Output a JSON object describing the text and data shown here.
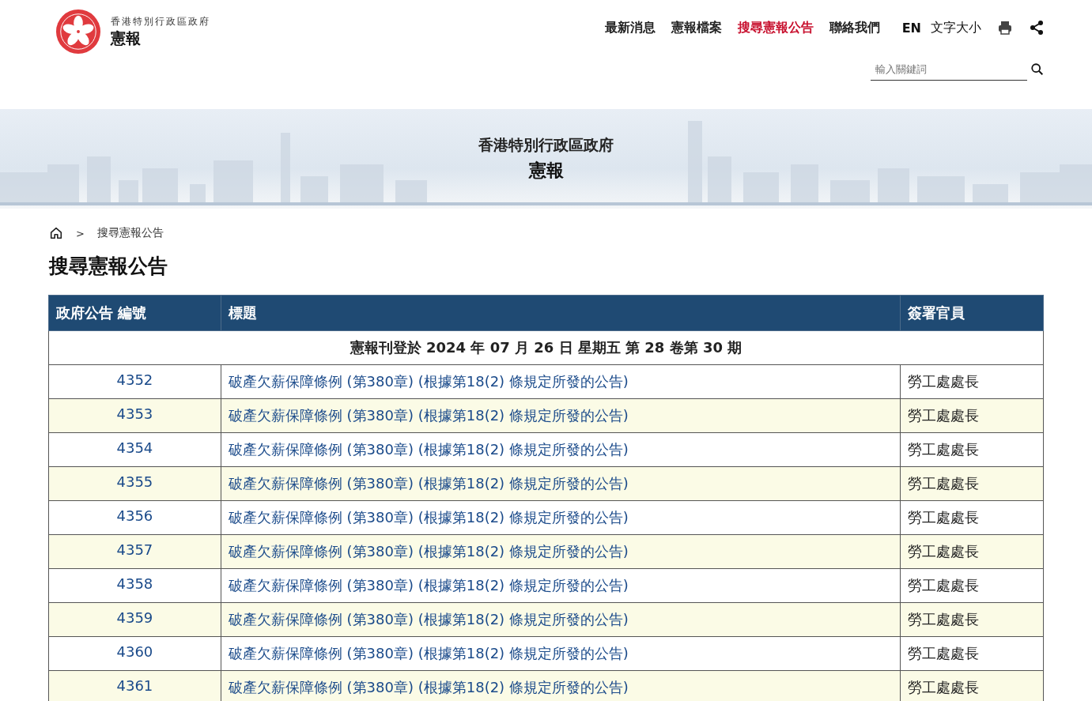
{
  "header": {
    "logo_subtitle": "香港特別行政區政府",
    "logo_title": "憲報",
    "nav": [
      {
        "label": "最新消息",
        "selected": false
      },
      {
        "label": "憲報檔案",
        "selected": false
      },
      {
        "label": "搜尋憲報公告",
        "selected": true
      },
      {
        "label": "聯絡我們",
        "selected": false
      }
    ],
    "language": "EN",
    "font_size": "文字大小",
    "search": {
      "placeholder": "輸入關鍵詞"
    }
  },
  "banner": {
    "subtitle": "香港特別行政區政府",
    "title": "憲報"
  },
  "breadcrumb": {
    "separator": ">",
    "current": "搜尋憲報公告"
  },
  "page_title": "搜尋憲報公告",
  "table": {
    "columns": [
      "政府公告 編號",
      "標題",
      "簽署官員"
    ],
    "group_heading": "憲報刊登於 2024 年 07 月 26 日 星期五 第 28 卷第 30 期",
    "rows": [
      {
        "number": "4352",
        "title": "破產欠薪保障條例 (第380章) (根據第18(2) 條規定所發的公告)",
        "officer": "勞工處處長"
      },
      {
        "number": "4353",
        "title": "破產欠薪保障條例 (第380章) (根據第18(2) 條規定所發的公告)",
        "officer": "勞工處處長"
      },
      {
        "number": "4354",
        "title": "破產欠薪保障條例 (第380章) (根據第18(2) 條規定所發的公告)",
        "officer": "勞工處處長"
      },
      {
        "number": "4355",
        "title": "破產欠薪保障條例 (第380章) (根據第18(2) 條規定所發的公告)",
        "officer": "勞工處處長"
      },
      {
        "number": "4356",
        "title": "破產欠薪保障條例 (第380章) (根據第18(2) 條規定所發的公告)",
        "officer": "勞工處處長"
      },
      {
        "number": "4357",
        "title": "破產欠薪保障條例 (第380章) (根據第18(2) 條規定所發的公告)",
        "officer": "勞工處處長"
      },
      {
        "number": "4358",
        "title": "破產欠薪保障條例 (第380章) (根據第18(2) 條規定所發的公告)",
        "officer": "勞工處處長"
      },
      {
        "number": "4359",
        "title": "破產欠薪保障條例 (第380章) (根據第18(2) 條規定所發的公告)",
        "officer": "勞工處處長"
      },
      {
        "number": "4360",
        "title": "破產欠薪保障條例 (第380章) (根據第18(2) 條規定所發的公告)",
        "officer": "勞工處處長"
      },
      {
        "number": "4361",
        "title": "破產欠薪保障條例 (第380章) (根據第18(2) 條規定所發的公告)",
        "officer": "勞工處處長"
      }
    ]
  }
}
